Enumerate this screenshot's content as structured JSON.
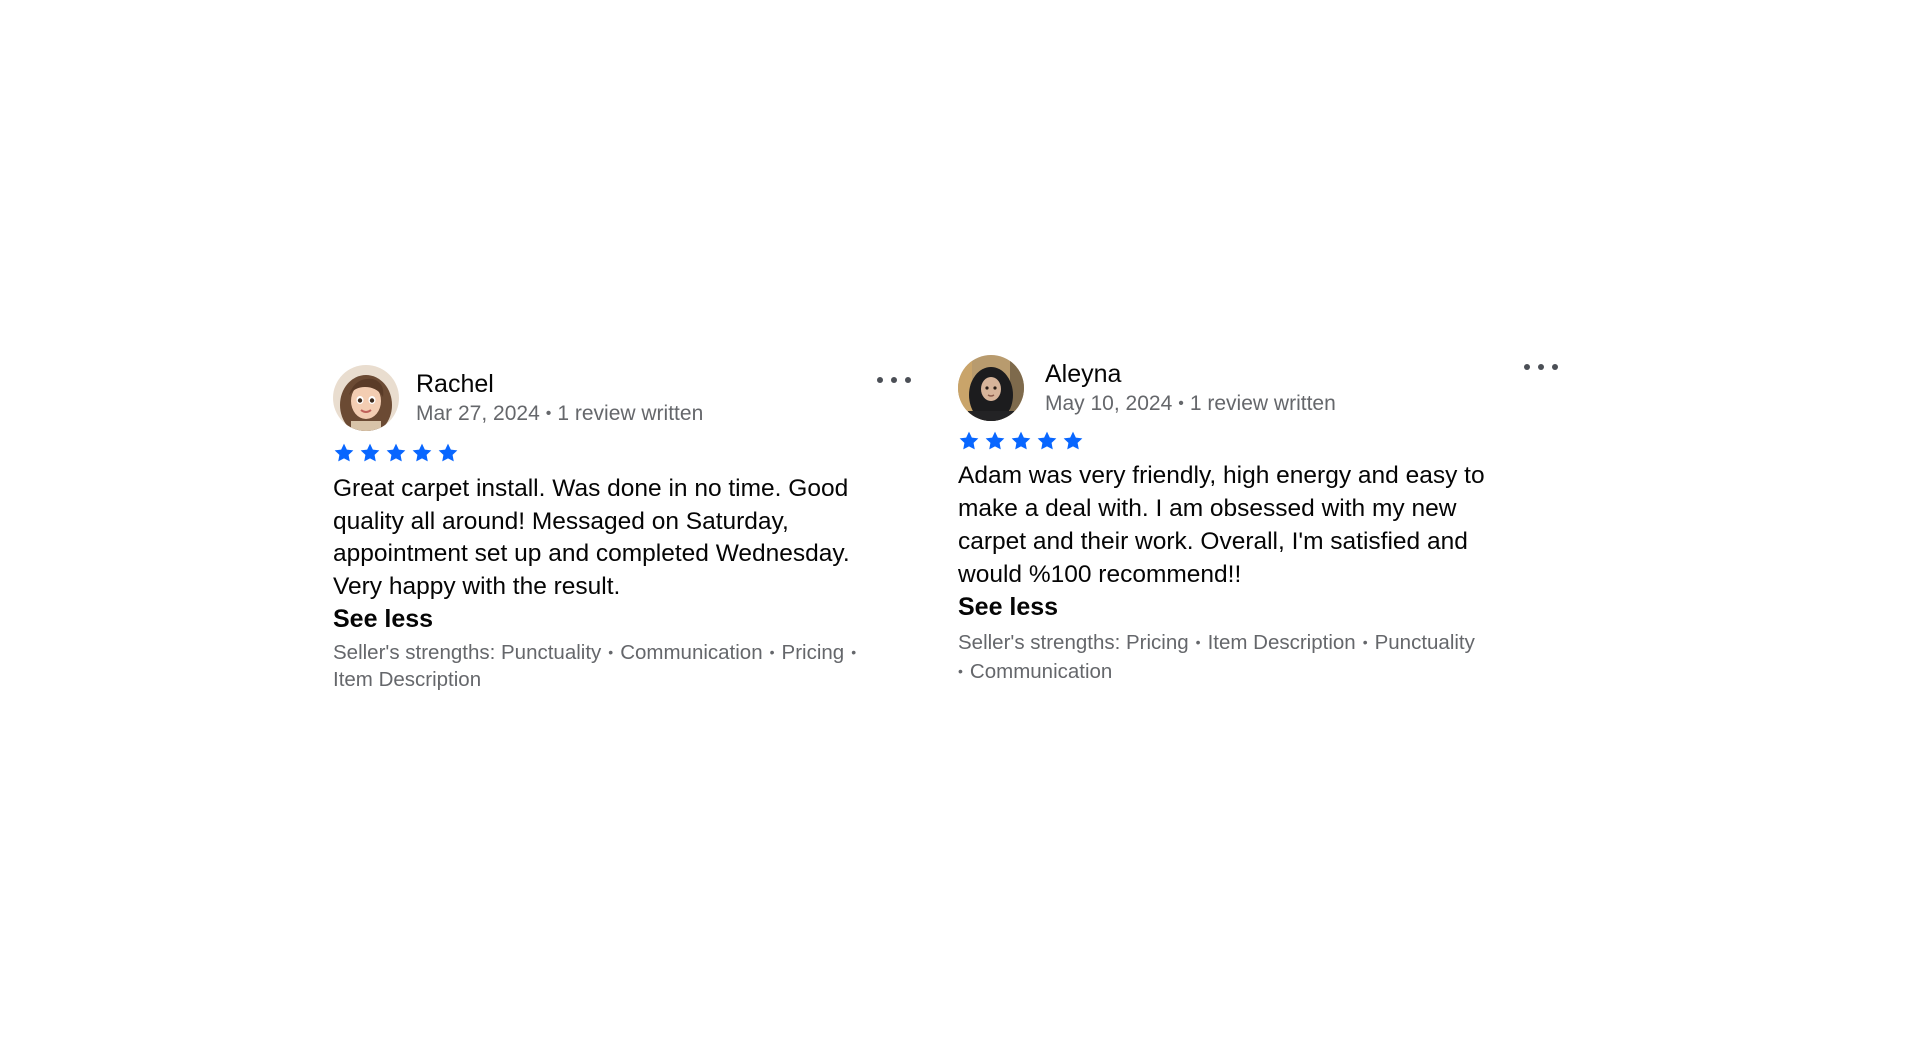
{
  "accent_color": "#0866ff",
  "reviews": [
    {
      "reviewer_name": "Rachel",
      "date": "Mar 27, 2024",
      "review_count": "1 review written",
      "rating": 5,
      "text_lines": [
        "Great carpet install. Was done in no time. Good",
        "quality all around! Messaged on Saturday,",
        "appointment set up and completed Wednesday.",
        "Very happy with the result."
      ],
      "see_less_label": "See less",
      "strengths_prefix": "Seller's strengths:",
      "strengths": [
        "Punctuality",
        "Communication",
        "Pricing",
        "Item Description"
      ],
      "more_icon": "more-horizontal-icon",
      "avatar_icon": "avatar"
    },
    {
      "reviewer_name": "Aleyna",
      "date": "May 10, 2024",
      "review_count": "1 review written",
      "rating": 5,
      "text_lines": [
        "Adam was very friendly, high energy and easy to",
        "make a deal with. I  am obsessed with my new",
        "carpet and their work. Overall, I'm satisfied and",
        "would %100 recommend!!"
      ],
      "see_less_label": "See less",
      "strengths_prefix": "Seller's strengths:",
      "strengths": [
        "Pricing",
        "Item Description",
        "Punctuality",
        "Communication"
      ],
      "more_icon": "more-horizontal-icon",
      "avatar_icon": "avatar"
    }
  ],
  "separator": "•"
}
